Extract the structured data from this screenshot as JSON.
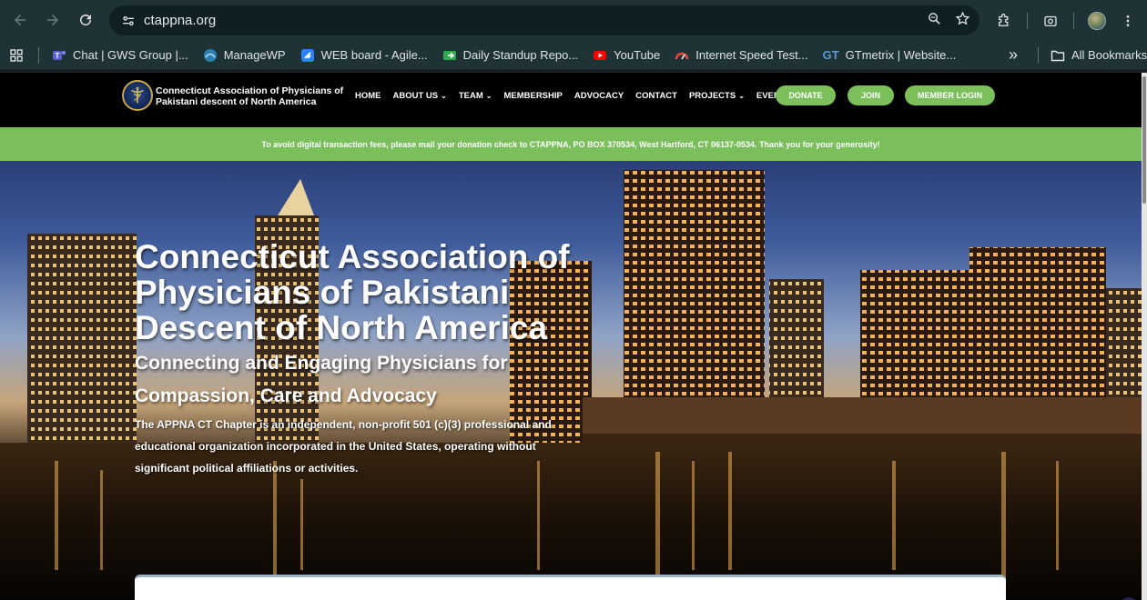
{
  "browser": {
    "url": "ctappna.org",
    "bookmarks": [
      {
        "label": "Chat | GWS Group |...",
        "icon": "teams-icon"
      },
      {
        "label": "ManageWP",
        "icon": "managewp-icon"
      },
      {
        "label": "WEB board - Agile...",
        "icon": "jira-icon"
      },
      {
        "label": "Daily Standup Repo...",
        "icon": "sheets-icon"
      },
      {
        "label": "YouTube",
        "icon": "youtube-icon"
      },
      {
        "label": "Internet Speed Test...",
        "icon": "speedtest-icon"
      },
      {
        "label": "GTmetrix | Website...",
        "icon": "gtmetrix-icon"
      }
    ],
    "gtmetrix_prefix": "GT",
    "all_bookmarks": "All Bookmarks",
    "more_glyph": "»"
  },
  "site": {
    "logo_text": "Connecticut Association of Physicians of Pakistani descent of North America",
    "menu": [
      {
        "label": "HOME",
        "dropdown": false
      },
      {
        "label": "ABOUT US",
        "dropdown": true
      },
      {
        "label": "TEAM",
        "dropdown": true
      },
      {
        "label": "MEMBERSHIP",
        "dropdown": false
      },
      {
        "label": "ADVOCACY",
        "dropdown": false
      },
      {
        "label": "CONTACT",
        "dropdown": false
      },
      {
        "label": "PROJECTS",
        "dropdown": true
      },
      {
        "label": "EVENTS",
        "dropdown": true
      }
    ],
    "buttons": {
      "donate": "DONATE",
      "join": "JOIN",
      "member_login": "MEMBER LOGIN"
    },
    "notice": "To avoid digital transaction fees, please mail your donation check to CTAPPNA, PO BOX 370534, West Hartford, CT 06137-0534. Thank you for your generosity!",
    "hero": {
      "title": "Connecticut Association of Physicians of Pakistani Descent of North America",
      "subtitle": "Connecting and Engaging Physicians for Compassion, Care and Advocacy",
      "description": "The APPNA CT Chapter is an independent, non-profit 501 (c)(3) professional and educational organization incorporated in the United States, operating without significant political affiliations or activities."
    }
  },
  "colors": {
    "accent_green": "#7bc05a",
    "header_bg": "#000000",
    "chrome_bg": "#1f3337"
  }
}
